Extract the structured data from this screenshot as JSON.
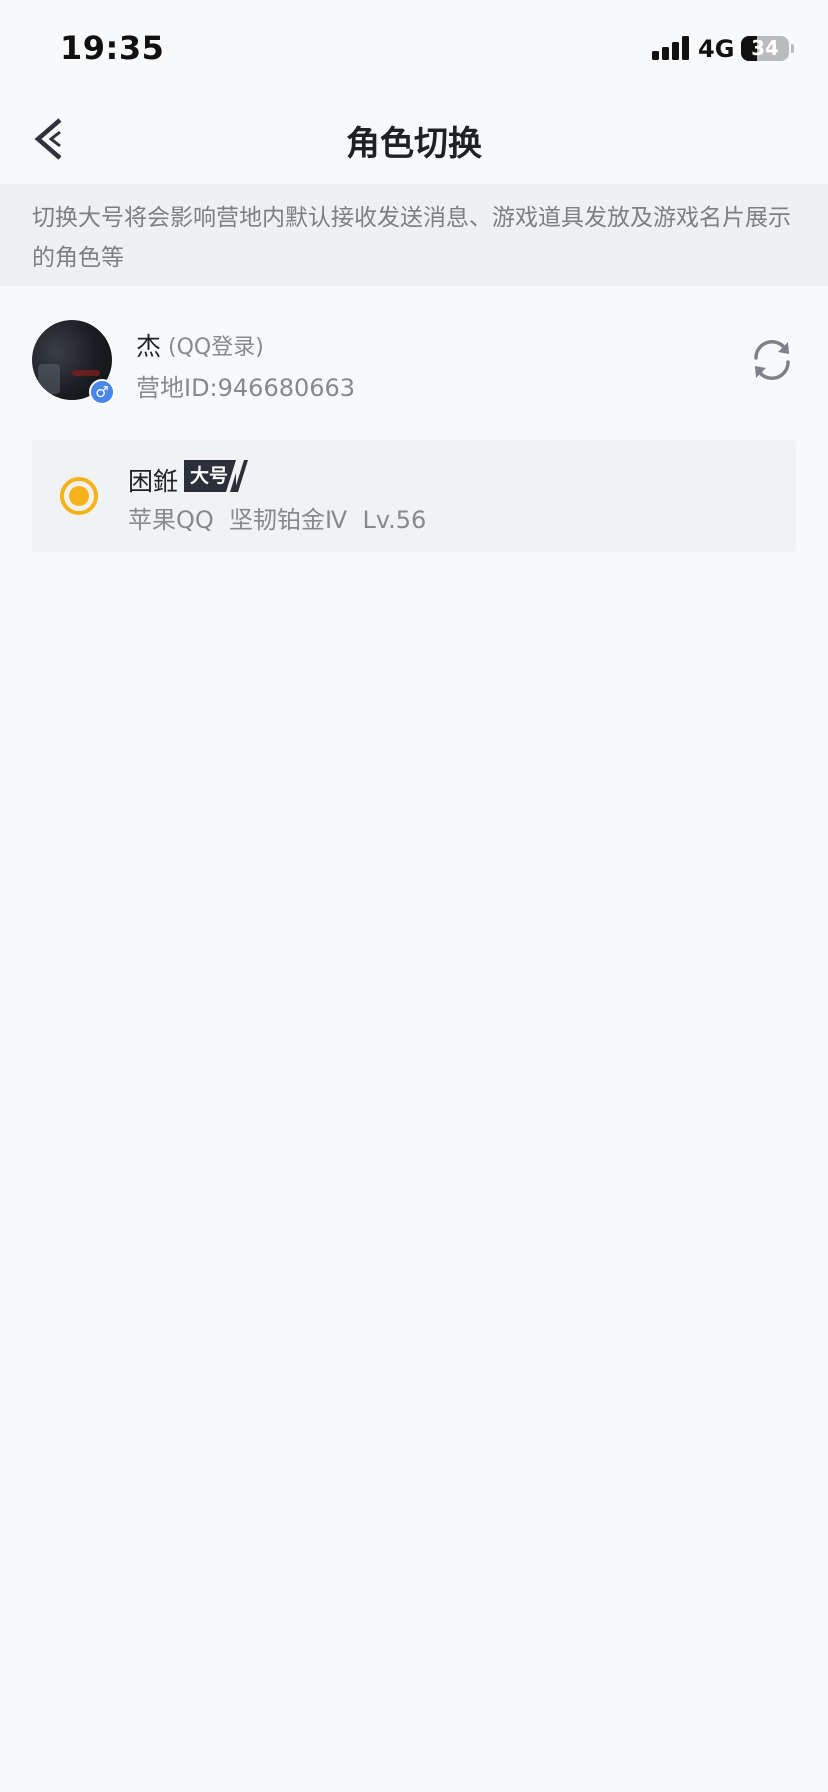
{
  "status_bar": {
    "time": "19:35",
    "network": "4G",
    "battery_percent": "34",
    "battery_level": 0.34
  },
  "nav": {
    "title": "角色切换",
    "back_icon": "chevron-left-icon"
  },
  "notice": {
    "text": "切换大号将会影响营地内默认接收发送消息、游戏道具发放及游戏名片展示的角色等"
  },
  "account": {
    "name": "杰",
    "login_type": "(QQ登录)",
    "camp_id": "营地ID:946680663",
    "gender_icon": "male-icon",
    "gender_symbol": "♂",
    "refresh_icon": "refresh-icon"
  },
  "roles": [
    {
      "name": "困銋",
      "badge": "大号",
      "info": "苹果QQ  坚韧铂金Ⅳ  Lv.56",
      "selected": true
    }
  ],
  "colors": {
    "accent": "#f5b21a",
    "badge_bg": "#2a2f3a",
    "notice_bg": "#eff0f2",
    "gender_blue": "#4a86e8"
  }
}
